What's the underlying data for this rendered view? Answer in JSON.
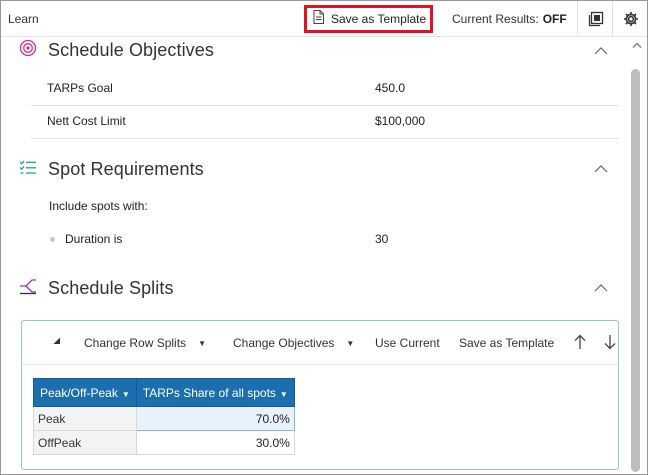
{
  "header": {
    "app_title": "Learn",
    "save_template_label": "Save as Template",
    "current_results_label": "Current Results:",
    "current_results_value": "OFF",
    "icons": [
      "save-template-icon",
      "export-icon",
      "gear-icon"
    ]
  },
  "sections": {
    "objectives": {
      "title": "Schedule Objectives",
      "icon": "target-icon",
      "rows": [
        {
          "label": "TARPs Goal",
          "value": "450.0"
        },
        {
          "label": "Nett Cost Limit",
          "value": "$100,000"
        }
      ]
    },
    "spot_requirements": {
      "title": "Spot Requirements",
      "icon": "checklist-icon",
      "intro": "Include spots with:",
      "rows": [
        {
          "label": "Duration is",
          "value": "30"
        }
      ]
    },
    "splits": {
      "title": "Schedule Splits",
      "icon": "split-icon",
      "toolbar": {
        "change_row_splits": "Change Row Splits",
        "change_objectives": "Change Objectives",
        "use_current": "Use Current",
        "save_as_template": "Save as Template"
      },
      "table": {
        "columns": [
          "Peak/Off-Peak",
          "TARPs Share of all spots"
        ],
        "rows": [
          {
            "label": "Peak",
            "value": "70.0%"
          },
          {
            "label": "OffPeak",
            "value": "30.0%"
          }
        ]
      }
    }
  },
  "colors": {
    "highlight_border": "#e0141e",
    "accent_pink": "#d62a8a",
    "accent_teal": "#1aa39a",
    "accent_purple": "#9b2fae",
    "table_header": "#1b6fae"
  }
}
